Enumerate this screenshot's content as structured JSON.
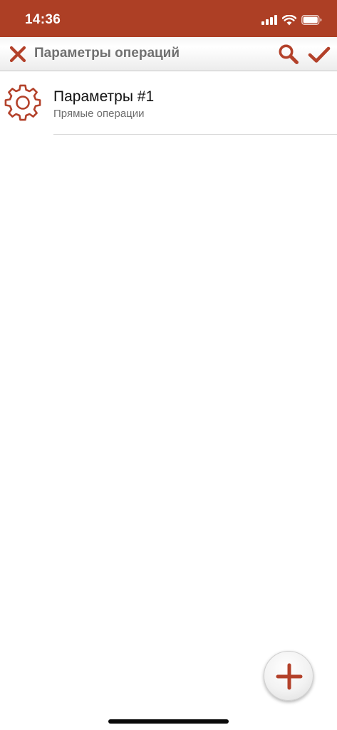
{
  "status_bar": {
    "time": "14:36",
    "icons": [
      "signal-icon",
      "wifi-icon",
      "battery-icon"
    ]
  },
  "nav": {
    "title": "Параметры операций",
    "icons": [
      "close-icon",
      "search-icon",
      "checkmark-icon"
    ]
  },
  "list": {
    "items": [
      {
        "title": "Параметры #1",
        "subtitle": "Прямые операции",
        "icon": "gear-icon"
      }
    ]
  },
  "fab": {
    "icon": "plus-icon"
  },
  "colors": {
    "accent": "#ad3f25",
    "title_gray": "#707070",
    "icon_red": "#b3412a"
  }
}
